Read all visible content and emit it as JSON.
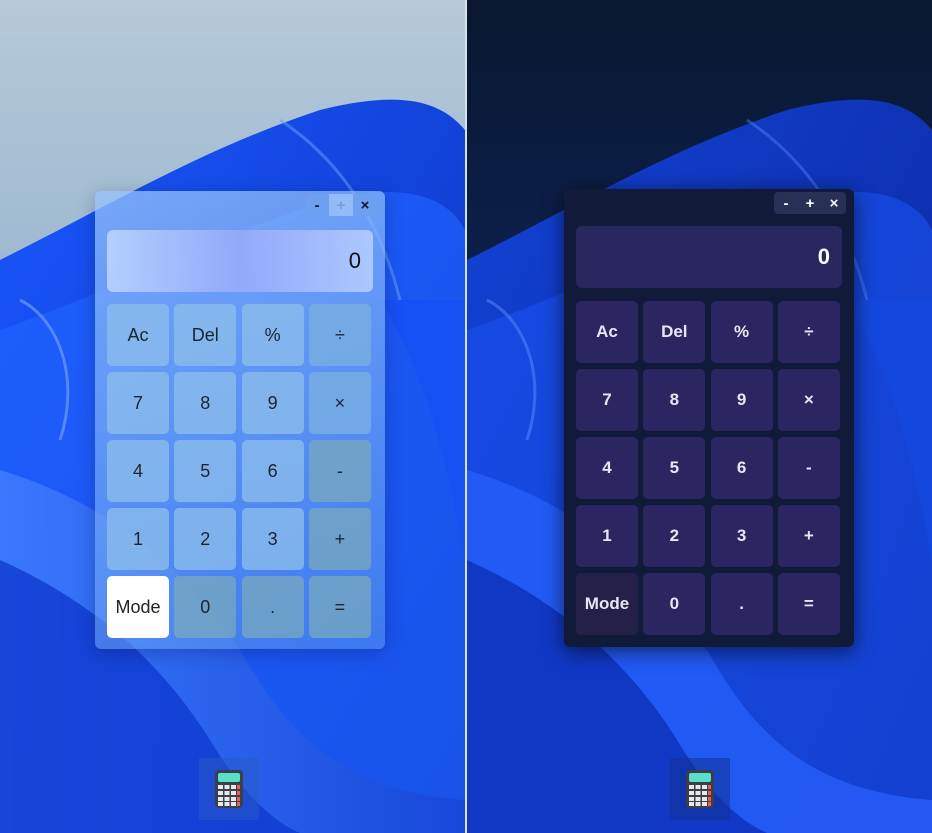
{
  "window_controls": {
    "minimize": "-",
    "maximize": "+",
    "close": "×"
  },
  "display_value": "0",
  "keys": [
    "Ac",
    "Del",
    "%",
    "÷",
    "7",
    "8",
    "9",
    "×",
    "4",
    "5",
    "6",
    "-",
    "1",
    "2",
    "3",
    "+",
    "Mode",
    "0",
    ".",
    "="
  ],
  "taskbar_icon": "calculator-app-icon",
  "colors": {
    "light_accent": "#4c8df0",
    "dark_window": "#121a3a",
    "dark_key": "#2b2561",
    "wallpaper_blue": "#1e5cf0"
  }
}
